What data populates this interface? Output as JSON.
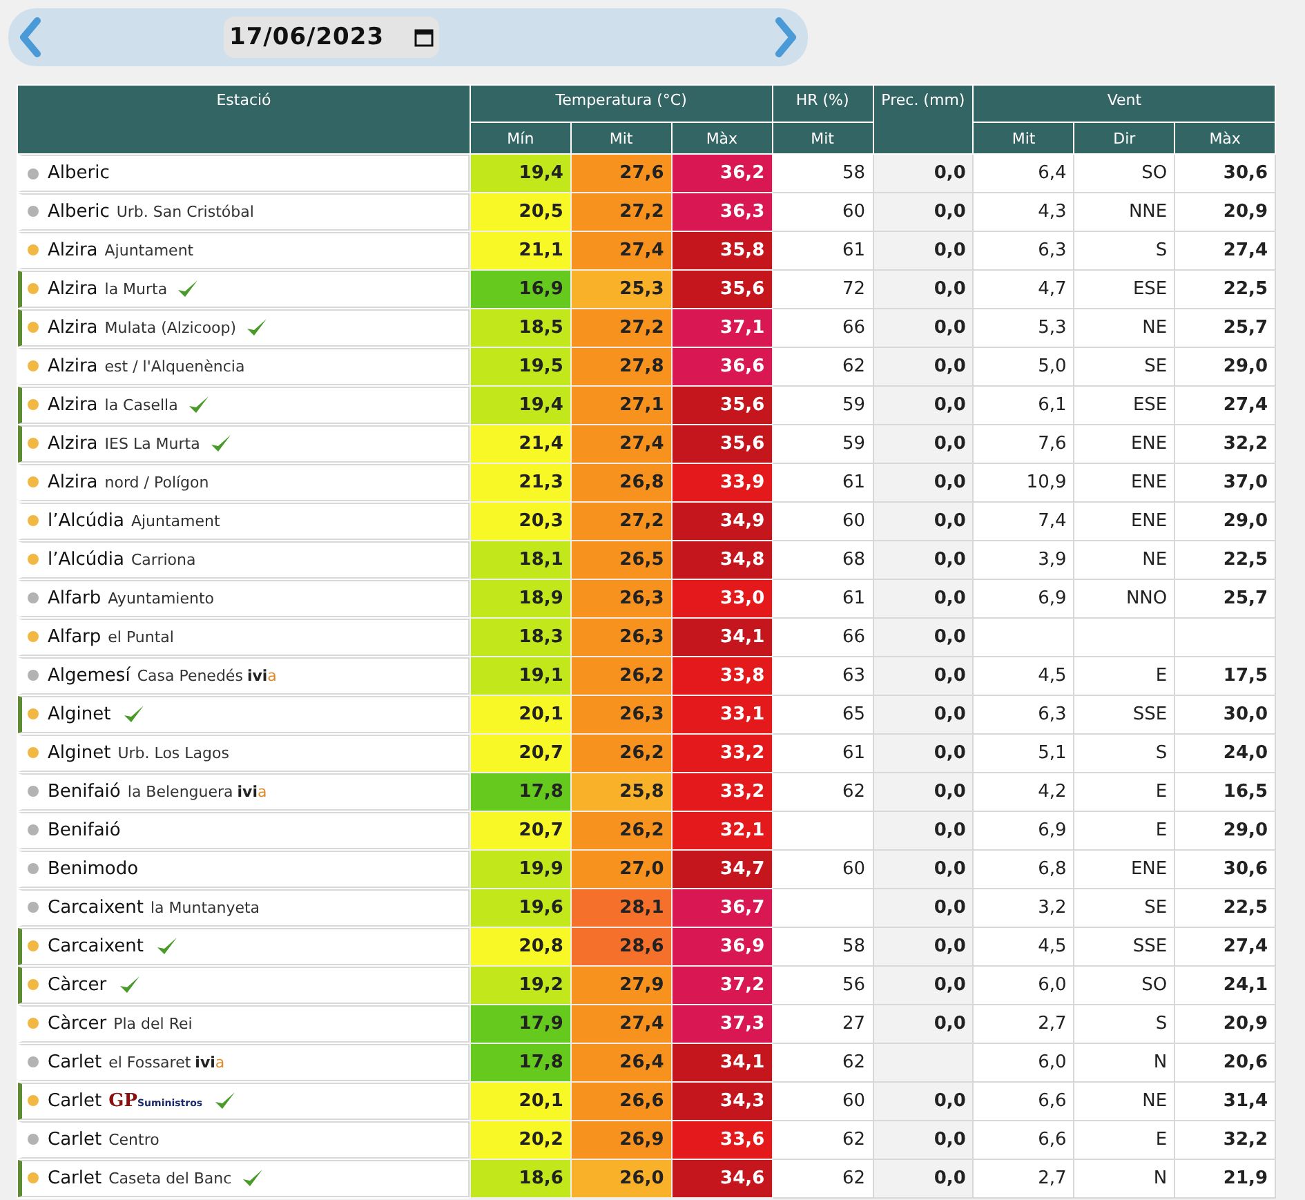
{
  "date_bar": {
    "date": "17/06/2023"
  },
  "table": {
    "groups": [
      {
        "label": "Estació"
      },
      {
        "label": "Temperatura (°C)",
        "subcolumns": [
          "Mín",
          "Mit",
          "Màx"
        ]
      },
      {
        "label": "HR (%)",
        "subcolumns": [
          "Mit"
        ]
      },
      {
        "label": "Prec. (mm)"
      },
      {
        "label": "Vent",
        "subcolumns": [
          "Mit",
          "Dir",
          "Màx"
        ]
      }
    ],
    "rows": [
      {
        "name": "Alberic",
        "color": "#b3b3b3",
        "verified": false,
        "min": {
          "value": "19,4",
          "color": "#c2e81c"
        },
        "mit": {
          "value": "27,6",
          "color": "#f7921e"
        },
        "max": {
          "value": "36,2",
          "color": "#d91752"
        },
        "hr": "58",
        "prec": "0,0",
        "wind": "6,4",
        "dir": "SO",
        "gust": "30,6"
      },
      {
        "name": "Alberic",
        "place": "Urb. San Cristóbal",
        "color": "#b3b3b3",
        "verified": false,
        "min": {
          "value": "20,5",
          "color": "#f8f826"
        },
        "mit": {
          "value": "27,2",
          "color": "#f7921e"
        },
        "max": {
          "value": "36,3",
          "color": "#d91752"
        },
        "hr": "60",
        "prec": "0,0",
        "wind": "4,3",
        "dir": "NNE",
        "gust": "20,9"
      },
      {
        "name": "Alzira",
        "place": "Ajuntament",
        "color": "#f2b844",
        "verified": false,
        "min": {
          "value": "21,1",
          "color": "#f8f826"
        },
        "mit": {
          "value": "27,4",
          "color": "#f7921e"
        },
        "max": {
          "value": "35,8",
          "color": "#c4161c"
        },
        "hr": "61",
        "prec": "0,0",
        "wind": "6,3",
        "dir": "S",
        "gust": "27,4"
      },
      {
        "name": "Alzira",
        "place": "la Murta",
        "color": "#f2b844",
        "verified": true,
        "min": {
          "value": "16,9",
          "color": "#66c91e"
        },
        "mit": {
          "value": "25,3",
          "color": "#f9b12a"
        },
        "max": {
          "value": "35,6",
          "color": "#c4161c"
        },
        "hr": "72",
        "prec": "0,0",
        "wind": "4,7",
        "dir": "ESE",
        "gust": "22,5"
      },
      {
        "name": "Alzira",
        "place": "Mulata (Alzicoop)",
        "color": "#f2b844",
        "verified": true,
        "min": {
          "value": "18,5",
          "color": "#c2e81c"
        },
        "mit": {
          "value": "27,2",
          "color": "#f7921e"
        },
        "max": {
          "value": "37,1",
          "color": "#d91752"
        },
        "hr": "66",
        "prec": "0,0",
        "wind": "5,3",
        "dir": "NE",
        "gust": "25,7"
      },
      {
        "name": "Alzira",
        "place": "est / l'Alquenència",
        "color": "#f2b844",
        "verified": false,
        "min": {
          "value": "19,5",
          "color": "#c2e81c"
        },
        "mit": {
          "value": "27,8",
          "color": "#f7921e"
        },
        "max": {
          "value": "36,6",
          "color": "#d91752"
        },
        "hr": "62",
        "prec": "0,0",
        "wind": "5,0",
        "dir": "SE",
        "gust": "29,0"
      },
      {
        "name": "Alzira",
        "place": "la Casella",
        "color": "#f2b844",
        "verified": true,
        "min": {
          "value": "19,4",
          "color": "#c2e81c"
        },
        "mit": {
          "value": "27,1",
          "color": "#f7921e"
        },
        "max": {
          "value": "35,6",
          "color": "#c4161c"
        },
        "hr": "59",
        "prec": "0,0",
        "wind": "6,1",
        "dir": "ESE",
        "gust": "27,4"
      },
      {
        "name": "Alzira",
        "place": "IES La Murta",
        "color": "#f2b844",
        "verified": true,
        "min": {
          "value": "21,4",
          "color": "#f8f826"
        },
        "mit": {
          "value": "27,4",
          "color": "#f7921e"
        },
        "max": {
          "value": "35,6",
          "color": "#c4161c"
        },
        "hr": "59",
        "prec": "0,0",
        "wind": "7,6",
        "dir": "ENE",
        "gust": "32,2"
      },
      {
        "name": "Alzira",
        "place": "nord / Polígon",
        "color": "#f2b844",
        "verified": false,
        "min": {
          "value": "21,3",
          "color": "#f8f826"
        },
        "mit": {
          "value": "26,8",
          "color": "#f7921e"
        },
        "max": {
          "value": "33,9",
          "color": "#e3191c"
        },
        "hr": "61",
        "prec": "0,0",
        "wind": "10,9",
        "dir": "ENE",
        "gust": "37,0"
      },
      {
        "name": "l’Alcúdia",
        "place": "Ajuntament",
        "color": "#f2b844",
        "verified": false,
        "min": {
          "value": "20,3",
          "color": "#f8f826"
        },
        "mit": {
          "value": "27,2",
          "color": "#f7921e"
        },
        "max": {
          "value": "34,9",
          "color": "#c4161c"
        },
        "hr": "60",
        "prec": "0,0",
        "wind": "7,4",
        "dir": "ENE",
        "gust": "29,0"
      },
      {
        "name": "l’Alcúdia",
        "place": "Carriona",
        "color": "#f2b844",
        "verified": false,
        "min": {
          "value": "18,1",
          "color": "#c2e81c"
        },
        "mit": {
          "value": "26,5",
          "color": "#f7921e"
        },
        "max": {
          "value": "34,8",
          "color": "#c4161c"
        },
        "hr": "68",
        "prec": "0,0",
        "wind": "3,9",
        "dir": "NE",
        "gust": "22,5"
      },
      {
        "name": "Alfarb",
        "place": "Ayuntamiento",
        "color": "#b3b3b3",
        "verified": false,
        "min": {
          "value": "18,9",
          "color": "#c2e81c"
        },
        "mit": {
          "value": "26,3",
          "color": "#f7921e"
        },
        "max": {
          "value": "33,0",
          "color": "#e3191c"
        },
        "hr": "61",
        "prec": "0,0",
        "wind": "6,9",
        "dir": "NNO",
        "gust": "25,7"
      },
      {
        "name": "Alfarp",
        "place": "el Puntal",
        "color": "#f2b844",
        "verified": false,
        "min": {
          "value": "18,3",
          "color": "#c2e81c"
        },
        "mit": {
          "value": "26,3",
          "color": "#f7921e"
        },
        "max": {
          "value": "34,1",
          "color": "#c4161c"
        },
        "hr": "66",
        "prec": "0,0"
      },
      {
        "name": "Algemesí",
        "place": "Casa Penedés",
        "logo": {
          "kind": "ivia",
          "main": "ivi",
          "accent": "a"
        },
        "color": "#b3b3b3",
        "verified": false,
        "min": {
          "value": "19,1",
          "color": "#c2e81c"
        },
        "mit": {
          "value": "26,2",
          "color": "#f7921e"
        },
        "max": {
          "value": "33,8",
          "color": "#e3191c"
        },
        "hr": "63",
        "prec": "0,0",
        "wind": "4,5",
        "dir": "E",
        "gust": "17,5"
      },
      {
        "name": "Alginet",
        "color": "#f2b844",
        "verified": true,
        "min": {
          "value": "20,1",
          "color": "#f8f826"
        },
        "mit": {
          "value": "26,3",
          "color": "#f7921e"
        },
        "max": {
          "value": "33,1",
          "color": "#e3191c"
        },
        "hr": "65",
        "prec": "0,0",
        "wind": "6,3",
        "dir": "SSE",
        "gust": "30,0"
      },
      {
        "name": "Alginet",
        "place": "Urb. Los Lagos",
        "color": "#f2b844",
        "verified": false,
        "min": {
          "value": "20,7",
          "color": "#f8f826"
        },
        "mit": {
          "value": "26,2",
          "color": "#f7921e"
        },
        "max": {
          "value": "33,2",
          "color": "#e3191c"
        },
        "hr": "61",
        "prec": "0,0",
        "wind": "5,1",
        "dir": "S",
        "gust": "24,0"
      },
      {
        "name": "Benifaió",
        "place": "la Belenguera",
        "logo": {
          "kind": "ivia",
          "main": "ivi",
          "accent": "a"
        },
        "color": "#b3b3b3",
        "verified": false,
        "min": {
          "value": "17,8",
          "color": "#66c91e"
        },
        "mit": {
          "value": "25,8",
          "color": "#f9b12a"
        },
        "max": {
          "value": "33,2",
          "color": "#e3191c"
        },
        "hr": "62",
        "prec": "0,0",
        "wind": "4,2",
        "dir": "E",
        "gust": "16,5"
      },
      {
        "name": "Benifaió",
        "color": "#b3b3b3",
        "verified": false,
        "min": {
          "value": "20,7",
          "color": "#f8f826"
        },
        "mit": {
          "value": "26,2",
          "color": "#f7921e"
        },
        "max": {
          "value": "32,1",
          "color": "#e3191c"
        },
        "prec": "0,0",
        "wind": "6,9",
        "dir": "E",
        "gust": "29,0"
      },
      {
        "name": "Benimodo",
        "color": "#b3b3b3",
        "verified": false,
        "min": {
          "value": "19,9",
          "color": "#c2e81c"
        },
        "mit": {
          "value": "27,0",
          "color": "#f7921e"
        },
        "max": {
          "value": "34,7",
          "color": "#c4161c"
        },
        "hr": "60",
        "prec": "0,0",
        "wind": "6,8",
        "dir": "ENE",
        "gust": "30,6"
      },
      {
        "name": "Carcaixent",
        "place": "la Muntanyeta",
        "color": "#b3b3b3",
        "verified": false,
        "min": {
          "value": "19,6",
          "color": "#c2e81c"
        },
        "mit": {
          "value": "28,1",
          "color": "#f5702a"
        },
        "max": {
          "value": "36,7",
          "color": "#d91752"
        },
        "prec": "0,0",
        "wind": "3,2",
        "dir": "SE",
        "gust": "22,5"
      },
      {
        "name": "Carcaixent",
        "color": "#f2b844",
        "verified": true,
        "min": {
          "value": "20,8",
          "color": "#f8f826"
        },
        "mit": {
          "value": "28,6",
          "color": "#f5702a"
        },
        "max": {
          "value": "36,9",
          "color": "#d91752"
        },
        "hr": "58",
        "prec": "0,0",
        "wind": "4,5",
        "dir": "SSE",
        "gust": "27,4"
      },
      {
        "name": "Càrcer",
        "color": "#f2b844",
        "verified": true,
        "min": {
          "value": "19,2",
          "color": "#c2e81c"
        },
        "mit": {
          "value": "27,9",
          "color": "#f7921e"
        },
        "max": {
          "value": "37,2",
          "color": "#d91752"
        },
        "hr": "56",
        "prec": "0,0",
        "wind": "6,0",
        "dir": "SO",
        "gust": "24,1"
      },
      {
        "name": "Càrcer",
        "place": "Pla del Rei",
        "color": "#f2b844",
        "verified": false,
        "min": {
          "value": "17,9",
          "color": "#66c91e"
        },
        "mit": {
          "value": "27,4",
          "color": "#f7921e"
        },
        "max": {
          "value": "37,3",
          "color": "#d91752"
        },
        "hr": "27",
        "prec": "0,0",
        "wind": "2,7",
        "dir": "S",
        "gust": "20,9"
      },
      {
        "name": "Carlet",
        "place": "el Fossaret",
        "logo": {
          "kind": "ivia",
          "main": "ivi",
          "accent": "a"
        },
        "color": "#b3b3b3",
        "verified": false,
        "min": {
          "value": "17,8",
          "color": "#66c91e"
        },
        "mit": {
          "value": "26,4",
          "color": "#f7921e"
        },
        "max": {
          "value": "34,1",
          "color": "#c4161c"
        },
        "hr": "62",
        "wind": "6,0",
        "dir": "N",
        "gust": "20,6"
      },
      {
        "name": "Carlet",
        "logo": {
          "kind": "gp",
          "main": "GP",
          "accent": "Suministros"
        },
        "color": "#f2b844",
        "verified": true,
        "min": {
          "value": "20,1",
          "color": "#f8f826"
        },
        "mit": {
          "value": "26,6",
          "color": "#f7921e"
        },
        "max": {
          "value": "34,3",
          "color": "#c4161c"
        },
        "hr": "60",
        "prec": "0,0",
        "wind": "6,6",
        "dir": "NE",
        "gust": "31,4"
      },
      {
        "name": "Carlet",
        "place": "Centro",
        "color": "#b3b3b3",
        "verified": false,
        "min": {
          "value": "20,2",
          "color": "#f8f826"
        },
        "mit": {
          "value": "26,9",
          "color": "#f7921e"
        },
        "max": {
          "value": "33,6",
          "color": "#e3191c"
        },
        "hr": "62",
        "prec": "0,0",
        "wind": "6,6",
        "dir": "E",
        "gust": "32,2"
      },
      {
        "name": "Carlet",
        "place": "Caseta del Banc",
        "color": "#f2b844",
        "verified": true,
        "min": {
          "value": "18,6",
          "color": "#c2e81c"
        },
        "mit": {
          "value": "26,0",
          "color": "#f9b12a"
        },
        "max": {
          "value": "34,6",
          "color": "#c4161c"
        },
        "hr": "62",
        "prec": "0,0",
        "wind": "2,7",
        "dir": "N",
        "gust": "21,9"
      }
    ]
  }
}
